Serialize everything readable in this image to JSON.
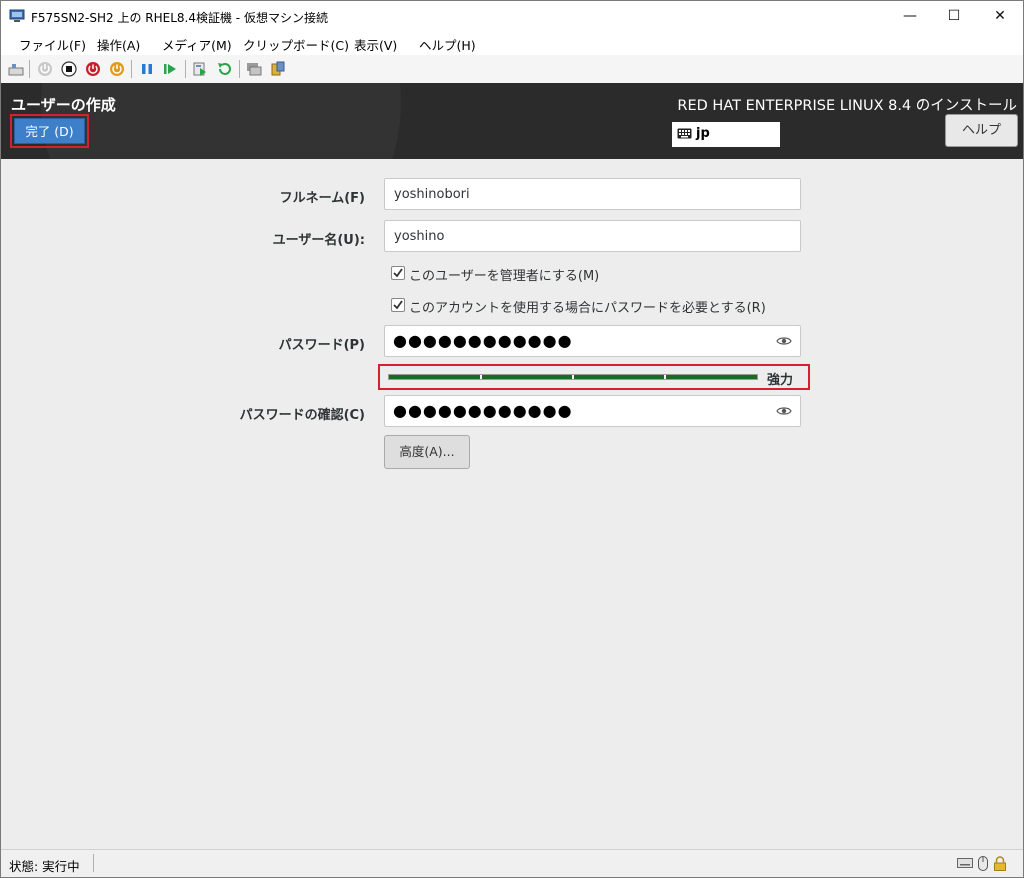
{
  "window": {
    "title": "F575SN2-SH2 上の RHEL8.4検証機 - 仮想マシン接続",
    "minimize_glyph": "—",
    "maximize_glyph": "☐",
    "close_glyph": "✕"
  },
  "menu": [
    "ファイル(F)",
    "操作(A)",
    "メディア(M)",
    "クリップボード(C)",
    "表示(V)",
    "ヘルプ(H)"
  ],
  "toolbar_icons": [
    "ctrl-alt-del-icon",
    "start-icon",
    "turn-off-icon",
    "shutdown-icon",
    "save-state-icon",
    "pause-icon",
    "resume-icon",
    "checkpoint-icon",
    "revert-icon",
    "enhanced-session-icon",
    "share-icon"
  ],
  "installer": {
    "screen_title": "ユーザーの作成",
    "done_button": "完了 (D)",
    "product_title": "RED HAT ENTERPRISE LINUX 8.4 のインストール",
    "keyboard_layout": "jp",
    "help_button": "ヘルプ"
  },
  "form": {
    "fullname_label": "フルネーム(F)",
    "fullname_value": "yoshinobori",
    "username_label": "ユーザー名(U):",
    "username_value": "yoshino",
    "admin_checkbox_label": "このユーザーを管理者にする(M)",
    "admin_checked": true,
    "require_password_label": "このアカウントを使用する場合にパスワードを必要とする(R)",
    "require_password_checked": true,
    "password_label": "パスワード(P)",
    "password_mask": "●●●●●●●●●●●●",
    "strength_label": "強力",
    "strength_fraction": 1.0,
    "confirm_label": "パスワードの確認(C)",
    "confirm_mask": "●●●●●●●●●●●●",
    "advanced_button": "高度(A)..."
  },
  "status": {
    "text": "状態: 実行中"
  },
  "colors": {
    "header_bg": "#2b2b2b",
    "done_blue": "#3e7fca",
    "highlight_red": "#d3212e",
    "strength_green": "#1a6b1f"
  }
}
